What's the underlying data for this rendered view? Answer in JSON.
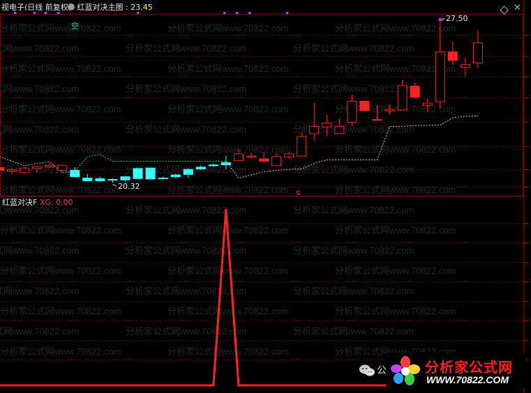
{
  "header": {
    "stock_title": "视电子(日线 前复权)",
    "indicator_name": "红蓝对决主图",
    "indicator_value": "23.45"
  },
  "main_panel": {
    "signal_label": "空",
    "high_label": "27.50",
    "low_label": "20.32",
    "marker_label": "s",
    "candles": [
      {
        "o": 21.02,
        "c": 20.9,
        "h": 21.08,
        "l": 20.8,
        "col": "red"
      },
      {
        "o": 20.86,
        "c": 20.92,
        "h": 21.02,
        "l": 20.72,
        "col": "red"
      },
      {
        "o": 20.8,
        "c": 21.0,
        "h": 21.06,
        "l": 20.72,
        "col": "red"
      },
      {
        "o": 20.98,
        "c": 21.06,
        "h": 21.1,
        "l": 20.8,
        "col": "red"
      },
      {
        "o": 21.05,
        "c": 21.12,
        "h": 21.2,
        "l": 20.98,
        "col": "red"
      },
      {
        "o": 20.9,
        "c": 21.12,
        "h": 21.14,
        "l": 20.86,
        "col": "red"
      },
      {
        "o": 20.9,
        "c": 20.62,
        "h": 21.04,
        "l": 20.6,
        "col": "cyan"
      },
      {
        "o": 20.56,
        "c": 20.44,
        "h": 20.74,
        "l": 20.44,
        "col": "cyan"
      },
      {
        "o": 20.54,
        "c": 20.44,
        "h": 20.62,
        "l": 20.4,
        "col": "cyan"
      },
      {
        "o": 20.5,
        "c": 20.5,
        "h": 20.56,
        "l": 20.36,
        "col": "cyan"
      },
      {
        "o": 20.62,
        "c": 20.48,
        "h": 20.66,
        "l": 20.42,
        "col": "cyan"
      },
      {
        "o": 20.98,
        "c": 20.54,
        "h": 20.98,
        "l": 20.54,
        "col": "cyan"
      },
      {
        "o": 21.0,
        "c": 20.52,
        "h": 21.0,
        "l": 20.52,
        "col": "cyan"
      },
      {
        "o": 20.56,
        "c": 20.56,
        "h": 20.62,
        "l": 20.5,
        "col": "cyan"
      },
      {
        "o": 20.7,
        "c": 20.62,
        "h": 20.76,
        "l": 20.56,
        "col": "cyan"
      },
      {
        "o": 20.94,
        "c": 20.72,
        "h": 20.98,
        "l": 20.56,
        "col": "cyan"
      },
      {
        "o": 21.04,
        "c": 20.96,
        "h": 21.12,
        "l": 20.92,
        "col": "cyan"
      },
      {
        "o": 21.14,
        "c": 21.1,
        "h": 21.18,
        "l": 21.06,
        "col": "cyan"
      },
      {
        "o": 21.24,
        "c": 21.14,
        "h": 21.54,
        "l": 20.96,
        "col": "cyan"
      },
      {
        "o": 21.32,
        "c": 21.62,
        "h": 21.84,
        "l": 21.32,
        "col": "red"
      },
      {
        "o": 21.48,
        "c": 21.52,
        "h": 21.66,
        "l": 21.4,
        "col": "red"
      },
      {
        "o": 21.4,
        "c": 21.3,
        "h": 21.7,
        "l": 21.24,
        "col": "red"
      },
      {
        "o": 21.1,
        "c": 21.5,
        "h": 21.66,
        "l": 21.1,
        "col": "red"
      },
      {
        "o": 21.48,
        "c": 21.62,
        "h": 21.7,
        "l": 21.42,
        "col": "red"
      },
      {
        "o": 21.52,
        "c": 22.38,
        "h": 22.58,
        "l": 21.5,
        "col": "red"
      },
      {
        "o": 22.5,
        "c": 22.82,
        "h": 23.84,
        "l": 22.2,
        "col": "red"
      },
      {
        "o": 22.8,
        "c": 22.96,
        "h": 23.32,
        "l": 22.4,
        "col": "red"
      },
      {
        "o": 22.5,
        "c": 22.82,
        "h": 23.16,
        "l": 22.5,
        "col": "red"
      },
      {
        "o": 23.0,
        "c": 23.92,
        "h": 24.2,
        "l": 22.82,
        "col": "red"
      },
      {
        "o": 23.92,
        "c": 23.52,
        "h": 23.92,
        "l": 23.52,
        "col": "red"
      },
      {
        "o": 23.12,
        "c": 23.12,
        "h": 23.74,
        "l": 23.08,
        "col": "red"
      },
      {
        "o": 23.5,
        "c": 23.56,
        "h": 23.76,
        "l": 23.36,
        "col": "red"
      },
      {
        "o": 23.54,
        "c": 24.6,
        "h": 24.84,
        "l": 23.54,
        "col": "red"
      },
      {
        "o": 24.58,
        "c": 24.1,
        "h": 24.74,
        "l": 24.04,
        "col": "red"
      },
      {
        "o": 23.74,
        "c": 23.84,
        "h": 24.04,
        "l": 23.46,
        "col": "red"
      },
      {
        "o": 23.9,
        "c": 26.08,
        "h": 27.5,
        "l": 23.6,
        "col": "red"
      },
      {
        "o": 26.08,
        "c": 25.7,
        "h": 26.52,
        "l": 25.5,
        "col": "red"
      },
      {
        "o": 25.4,
        "c": 25.52,
        "h": 25.84,
        "l": 25.0,
        "col": "red"
      },
      {
        "o": 25.6,
        "c": 26.48,
        "h": 27.04,
        "l": 25.36,
        "col": "red"
      }
    ],
    "support_line": [
      21.5,
      21.3,
      21.1,
      21.2,
      21.28,
      20.8,
      20.86,
      21.5,
      21.6,
      21.3,
      21.3,
      21.3,
      21.3,
      21.3,
      21.3,
      21.3,
      21.3,
      21.3,
      21.3,
      20.56,
      20.7,
      20.84,
      20.9,
      20.94,
      20.96,
      21.2,
      21.36,
      21.36,
      21.36,
      21.36,
      21.36,
      22.82,
      22.82,
      22.86,
      22.86,
      22.88,
      23.2,
      23.26,
      23.28
    ]
  },
  "sub_panel": {
    "name": "红蓝对决F",
    "series_label": "XG",
    "series_value": "0.00",
    "xg_values": [
      0,
      0,
      0,
      0,
      0,
      0,
      0,
      0,
      0,
      0,
      0,
      0,
      0,
      0,
      0,
      0,
      0,
      0,
      1,
      0,
      0,
      0,
      0,
      0,
      0,
      0,
      0,
      0,
      0,
      0,
      0,
      0,
      0,
      0,
      0,
      0,
      0,
      0,
      0
    ]
  },
  "watermark": {
    "text": "分析家公式网www.70822.com"
  },
  "logo": {
    "title": "分析家公式网",
    "url": "WWW.70822.COM"
  },
  "wechat_text": "公"
}
